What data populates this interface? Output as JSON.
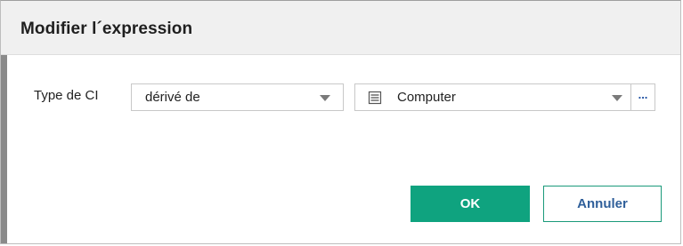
{
  "dialog": {
    "title": "Modifier l´expression"
  },
  "form": {
    "row_label": "Type de CI",
    "relation_select": {
      "value": "dérivé de"
    },
    "ci_type_select": {
      "value": "Computer",
      "icon": "server-icon"
    },
    "more_label": "..."
  },
  "buttons": {
    "ok_label": "OK",
    "cancel_label": "Annuler"
  },
  "colors": {
    "primary": "#0fa37f",
    "link": "#2f5f9a"
  }
}
